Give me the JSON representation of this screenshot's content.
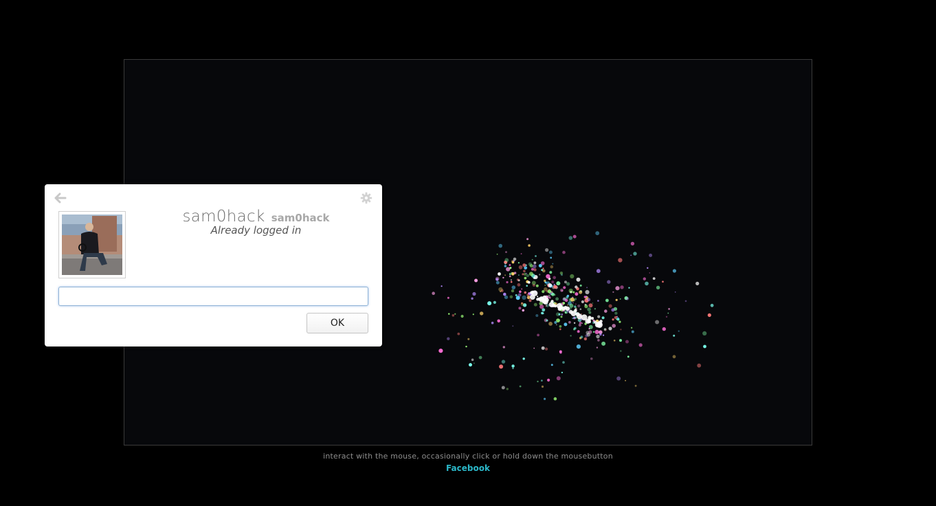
{
  "footer": {
    "instructions": "interact with the mouse, occasionally click or hold down the mousebutton",
    "link_label": "Facebook",
    "link_color": "#2bb7c8"
  },
  "dialog": {
    "back_icon": "arrow-left-icon",
    "settings_icon": "gear-icon",
    "avatar_alt": "profile photo",
    "display_name": "sam0hack",
    "username": "sam0hack",
    "status": "Already logged in",
    "password_value": "",
    "ok_label": "OK"
  }
}
